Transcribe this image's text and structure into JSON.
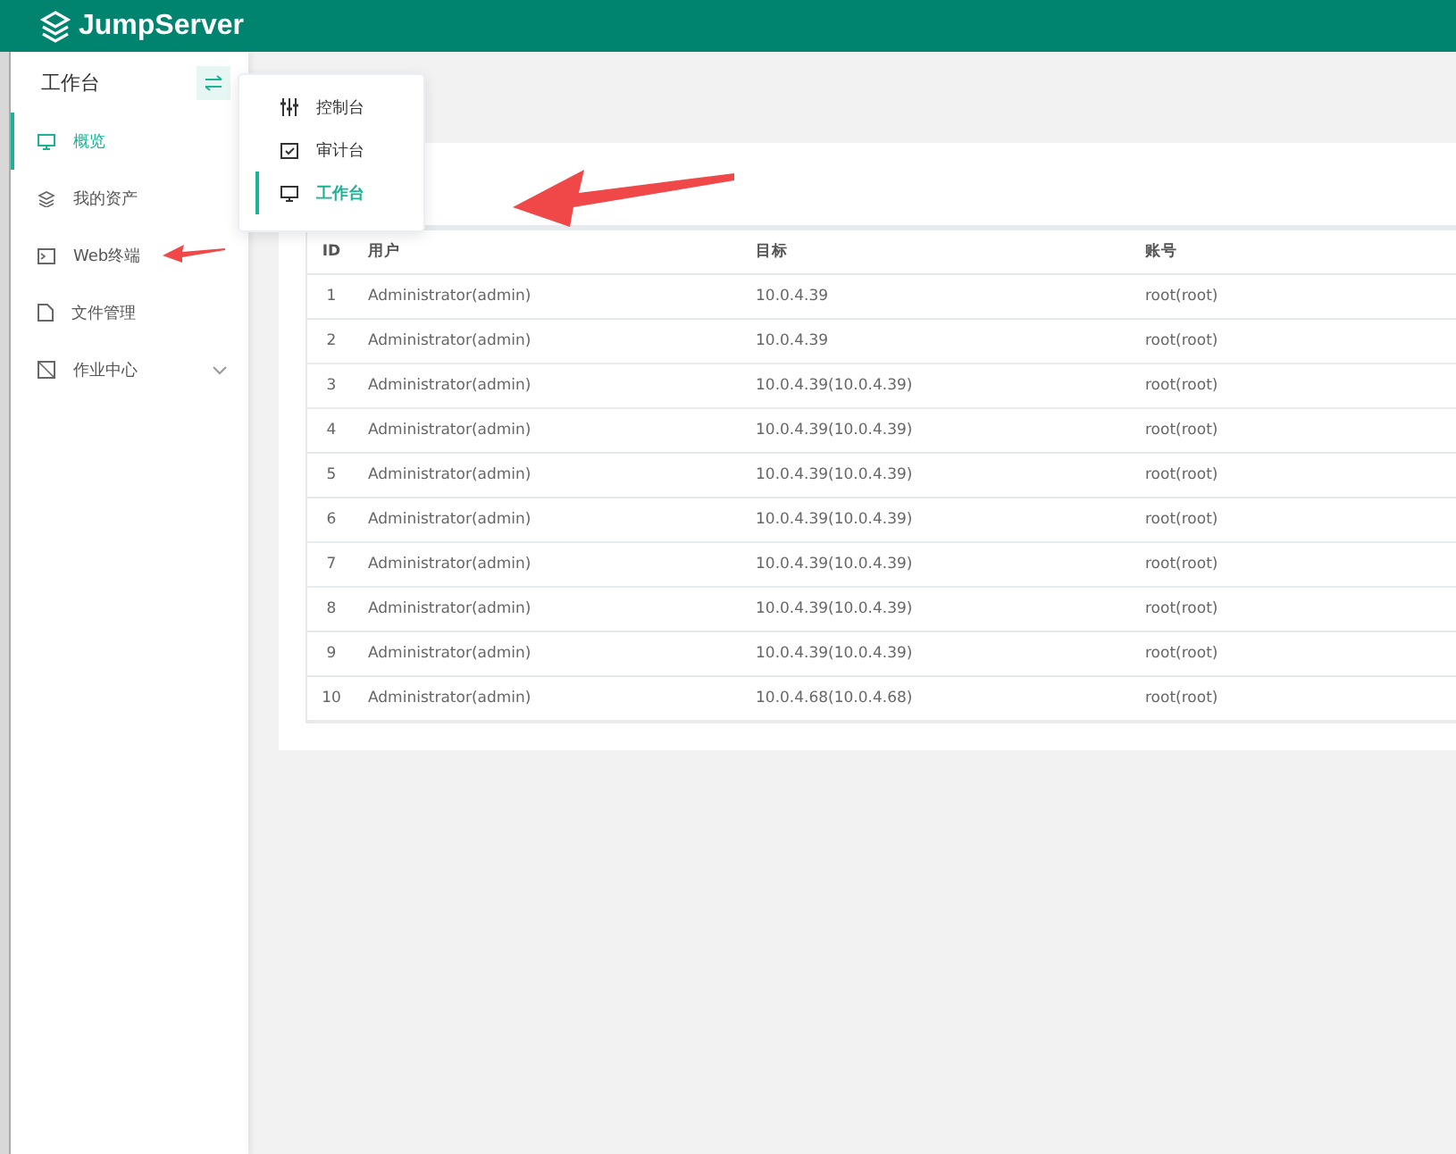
{
  "header": {
    "logo": "JumpServer"
  },
  "sidebar": {
    "title": "工作台",
    "items": [
      {
        "label": "概览",
        "kind": "monitor",
        "selected": true,
        "expandable": false
      },
      {
        "label": "我的资产",
        "kind": "layers",
        "selected": false,
        "expandable": false
      },
      {
        "label": "Web终端",
        "kind": "terminal",
        "selected": false,
        "expandable": false
      },
      {
        "label": "文件管理",
        "kind": "file",
        "selected": false,
        "expandable": false
      },
      {
        "label": "作业中心",
        "kind": "job",
        "selected": false,
        "expandable": true
      }
    ]
  },
  "view_menu": [
    {
      "label": "控制台",
      "kind": "sliders",
      "selected": false
    },
    {
      "label": "审计台",
      "kind": "audit",
      "selected": false
    },
    {
      "label": "工作台",
      "kind": "monitor",
      "selected": true
    }
  ],
  "table": {
    "columns": [
      "ID",
      "用户",
      "目标",
      "账号"
    ],
    "rows": [
      [
        "1",
        "Administrator(admin)",
        "10.0.4.39",
        "root(root)"
      ],
      [
        "2",
        "Administrator(admin)",
        "10.0.4.39",
        "root(root)"
      ],
      [
        "3",
        "Administrator(admin)",
        "10.0.4.39(10.0.4.39)",
        "root(root)"
      ],
      [
        "4",
        "Administrator(admin)",
        "10.0.4.39(10.0.4.39)",
        "root(root)"
      ],
      [
        "5",
        "Administrator(admin)",
        "10.0.4.39(10.0.4.39)",
        "root(root)"
      ],
      [
        "6",
        "Administrator(admin)",
        "10.0.4.39(10.0.4.39)",
        "root(root)"
      ],
      [
        "7",
        "Administrator(admin)",
        "10.0.4.39(10.0.4.39)",
        "root(root)"
      ],
      [
        "8",
        "Administrator(admin)",
        "10.0.4.39(10.0.4.39)",
        "root(root)"
      ],
      [
        "9",
        "Administrator(admin)",
        "10.0.4.39(10.0.4.39)",
        "root(root)"
      ],
      [
        "10",
        "Administrator(admin)",
        "10.0.4.68(10.0.4.68)",
        "root(root)"
      ]
    ]
  }
}
